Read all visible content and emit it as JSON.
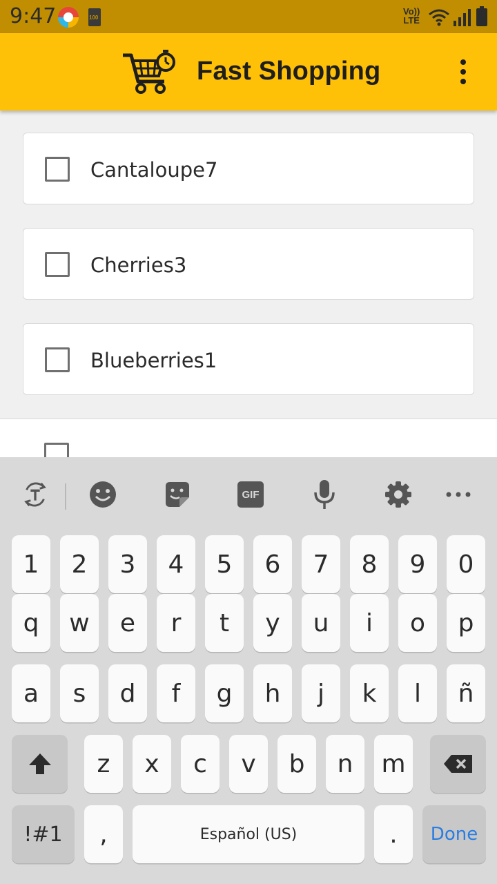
{
  "status_bar": {
    "time": "9:47",
    "battery_small_text": "100",
    "volte_top": "Vo))",
    "volte_bottom": "LTE"
  },
  "app_bar": {
    "title": "Fast Shopping",
    "background": "#ffc107",
    "logo_icon": "shopping-cart-timer-icon",
    "menu_icon": "more-vert-icon"
  },
  "items": [
    {
      "label": "Cantaloupe7",
      "checked": false
    },
    {
      "label": "Cherries3",
      "checked": false
    },
    {
      "label": "Blueberries1",
      "checked": false
    },
    {
      "label": "",
      "checked": false
    }
  ],
  "keyboard": {
    "toolbar_icons": [
      "translate-icon",
      "emoji-icon",
      "sticker-icon",
      "gif-icon",
      "microphone-icon",
      "settings-icon",
      "more-icon"
    ],
    "gif_label": "GIF",
    "row_numbers": [
      "1",
      "2",
      "3",
      "4",
      "5",
      "6",
      "7",
      "8",
      "9",
      "0"
    ],
    "row1": [
      "q",
      "w",
      "e",
      "r",
      "t",
      "y",
      "u",
      "i",
      "o",
      "p"
    ],
    "row2": [
      "a",
      "s",
      "d",
      "f",
      "g",
      "h",
      "j",
      "k",
      "l",
      "ñ"
    ],
    "row3": [
      "z",
      "x",
      "c",
      "v",
      "b",
      "n",
      "m"
    ],
    "symbols_label": "!#1",
    "comma_label": ",",
    "space_label": "Español (US)",
    "period_label": ".",
    "done_label": "Done",
    "accent_color": "#2a7de1"
  }
}
